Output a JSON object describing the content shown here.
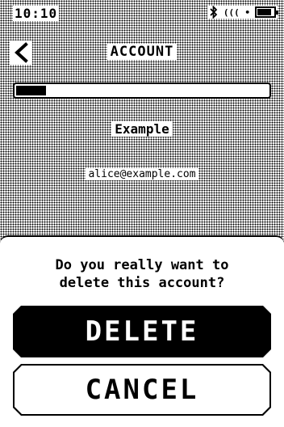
{
  "status_bar": {
    "time": "10:10",
    "signal_label": "((( •",
    "battery_level": 0.85,
    "icons": [
      "bluetooth-icon",
      "signal-icon",
      "battery-icon"
    ]
  },
  "header": {
    "title": "ACCOUNT",
    "back_icon": "chevron-left-icon"
  },
  "progress": {
    "fraction": 0.12
  },
  "account": {
    "name": "Example",
    "email": "alice@example.com"
  },
  "dialog": {
    "message": "Do you really want to\ndelete this account?",
    "delete_label": "DELETE",
    "cancel_label": "CANCEL"
  },
  "colors": {
    "foreground": "#000000",
    "background": "#ffffff"
  }
}
